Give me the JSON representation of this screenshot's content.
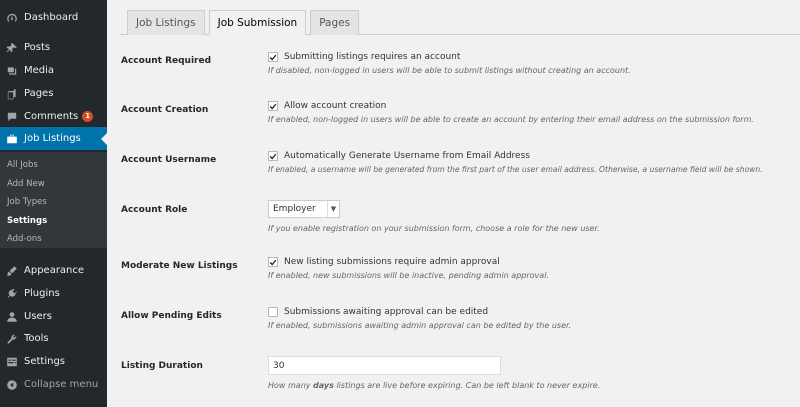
{
  "sidebar": {
    "items": [
      {
        "label": "Dashboard",
        "icon": "dashboard-icon"
      },
      {
        "label": "Posts",
        "icon": "pin-icon"
      },
      {
        "label": "Media",
        "icon": "media-icon"
      },
      {
        "label": "Pages",
        "icon": "page-icon"
      },
      {
        "label": "Comments",
        "icon": "comment-icon",
        "badge": "1"
      },
      {
        "label": "Job Listings",
        "icon": "briefcase-icon"
      },
      {
        "label": "Appearance",
        "icon": "brush-icon"
      },
      {
        "label": "Plugins",
        "icon": "plugin-icon"
      },
      {
        "label": "Users",
        "icon": "user-icon"
      },
      {
        "label": "Tools",
        "icon": "wrench-icon"
      },
      {
        "label": "Settings",
        "icon": "settings-icon"
      },
      {
        "label": "Collapse menu",
        "icon": "collapse-icon"
      }
    ],
    "submenu": [
      "All Jobs",
      "Add New",
      "Job Types",
      "Settings",
      "Add-ons"
    ]
  },
  "tabs": [
    "Job Listings",
    "Job Submission",
    "Pages"
  ],
  "settings": [
    {
      "label": "Account Required",
      "checkbox": "Submitting listings requires an account",
      "checked": true,
      "desc": "If disabled, non-logged in users will be able to submit listings without creating an account."
    },
    {
      "label": "Account Creation",
      "checkbox": "Allow account creation",
      "checked": true,
      "desc": "If enabled, non-logged in users will be able to create an account by entering their email address on the submission form."
    },
    {
      "label": "Account Username",
      "checkbox": "Automatically Generate Username from Email Address",
      "checked": true,
      "desc": "If enabled, a username will be generated from the first part of the user email address. Otherwise, a username field will be shown."
    },
    {
      "label": "Account Role",
      "select": "Employer",
      "desc": "If you enable registration on your submission form, choose a role for the new user."
    },
    {
      "label": "Moderate New Listings",
      "checkbox": "New listing submissions require admin approval",
      "checked": true,
      "desc": "If enabled, new submissions will be inactive, pending admin approval."
    },
    {
      "label": "Allow Pending Edits",
      "checkbox": "Submissions awaiting approval can be edited",
      "checked": false,
      "desc": "If enabled, submissions awaiting admin approval can be edited by the user."
    },
    {
      "label": "Listing Duration",
      "input": "30",
      "desc_pre": "How many ",
      "desc_bold": "days",
      "desc_post": " listings are live before expiring. Can be left blank to never expire."
    }
  ],
  "colors": {
    "sidebar_bg": "#23282d",
    "active": "#0073aa",
    "badge": "#d54e21"
  }
}
